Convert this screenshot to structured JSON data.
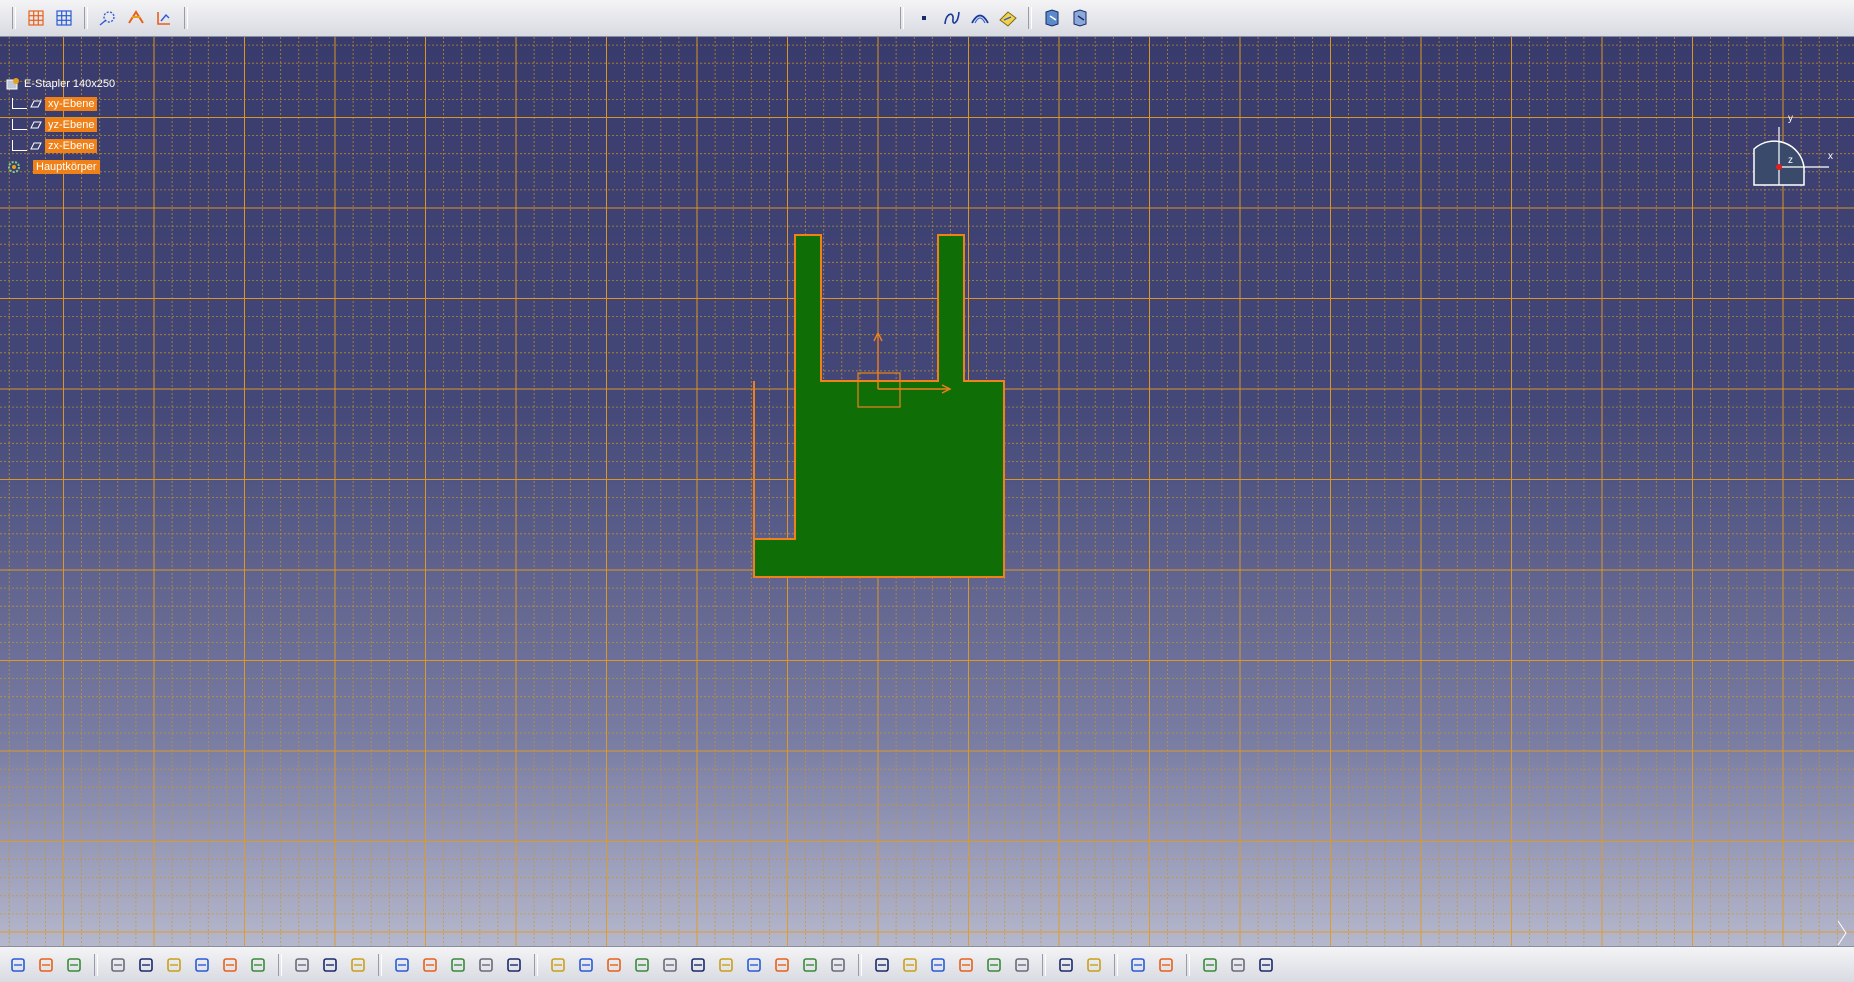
{
  "document": {
    "title": "E-Stapler 140x250"
  },
  "tree": {
    "root_label": "E-Stapler 140x250",
    "nodes": [
      {
        "label": "xy-Ebene",
        "icon": "plane-icon"
      },
      {
        "label": "yz-Ebene",
        "icon": "plane-icon"
      },
      {
        "label": "zx-Ebene",
        "icon": "plane-icon"
      },
      {
        "label": "Hauptkörper",
        "icon": "body-icon"
      }
    ]
  },
  "compass": {
    "x_label": "x",
    "y_label": "y",
    "z_label": "z"
  },
  "colors": {
    "background_top": "#383b6b",
    "background_bottom": "#b5b7cc",
    "grid": "#d99a2a",
    "sketch_fill": "#0f6e06",
    "sketch_edge": "#f08018",
    "highlight": "#f08018"
  },
  "top_toolbar": {
    "left_icons": [
      "grid-icon",
      "snap-grid-icon",
      "construction-geometry-icon",
      "cut-part-icon",
      "sketch-analysis-icon"
    ],
    "right_icons": [
      "point-icon",
      "spline-icon",
      "conic-icon",
      "profile-edit-icon",
      "exit-workbench-icon",
      "exit-workbench-2-icon"
    ]
  },
  "bottom_toolbar": {
    "icons": [
      "new-icon",
      "open-icon",
      "save-icon",
      "print-icon",
      "cut-icon",
      "copy-icon",
      "paste-icon",
      "undo-icon",
      "redo-icon",
      "whats-this-icon",
      "formula-icon",
      "comment-icon",
      "knowledge-icon",
      "table-icon",
      "tree-icon",
      "macro-icon",
      "tools-icon",
      "fly-icon",
      "fit-all-icon",
      "pan-icon",
      "rotate-icon",
      "zoom-in-icon",
      "zoom-out-icon",
      "normal-view-icon",
      "multi-view-icon",
      "iso-view-icon",
      "shading-icon",
      "hide-show-icon",
      "swap-icon",
      "constraint-icon",
      "dimension-icon",
      "constraint-list-icon",
      "analysis-icon",
      "measure-icon",
      "measure-item-icon",
      "camera-icon",
      "sketch-icon",
      "sketch-position-icon",
      "pocket-icon",
      "spline-tool-icon",
      "transform-icon"
    ]
  }
}
